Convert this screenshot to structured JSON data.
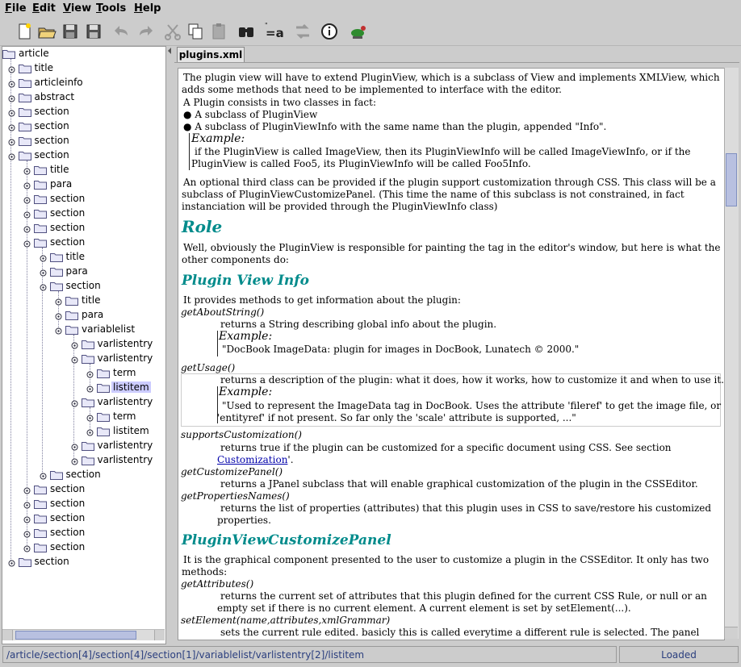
{
  "menu": [
    "File",
    "Edit",
    "View",
    "Tools",
    "Help"
  ],
  "toolbar": [
    "new-icon",
    "open-icon",
    "save-icon",
    "save-as-icon",
    "undo-icon",
    "redo-icon",
    "cut-icon",
    "copy-icon",
    "paste-icon",
    "find-icon",
    "replace-text-icon",
    "replace-icon",
    "about-icon",
    "plugin-icon"
  ],
  "tab_label": "plugins.xml",
  "tree": [
    {
      "label": "article",
      "level": 0,
      "handle": "none"
    },
    {
      "label": "title",
      "level": 1,
      "handle": "collapsed"
    },
    {
      "label": "articleinfo",
      "level": 1,
      "handle": "collapsed"
    },
    {
      "label": "abstract",
      "level": 1,
      "handle": "collapsed"
    },
    {
      "label": "section",
      "level": 1,
      "handle": "collapsed"
    },
    {
      "label": "section",
      "level": 1,
      "handle": "collapsed"
    },
    {
      "label": "section",
      "level": 1,
      "handle": "collapsed"
    },
    {
      "label": "section",
      "level": 1,
      "handle": "expanded"
    },
    {
      "label": "title",
      "level": 2,
      "handle": "collapsed"
    },
    {
      "label": "para",
      "level": 2,
      "handle": "collapsed"
    },
    {
      "label": "section",
      "level": 2,
      "handle": "collapsed"
    },
    {
      "label": "section",
      "level": 2,
      "handle": "collapsed"
    },
    {
      "label": "section",
      "level": 2,
      "handle": "collapsed"
    },
    {
      "label": "section",
      "level": 2,
      "handle": "expanded"
    },
    {
      "label": "title",
      "level": 3,
      "handle": "collapsed"
    },
    {
      "label": "para",
      "level": 3,
      "handle": "collapsed"
    },
    {
      "label": "section",
      "level": 3,
      "handle": "expanded"
    },
    {
      "label": "title",
      "level": 4,
      "handle": "collapsed"
    },
    {
      "label": "para",
      "level": 4,
      "handle": "collapsed"
    },
    {
      "label": "variablelist",
      "level": 4,
      "handle": "expanded"
    },
    {
      "label": "varlistentry",
      "level": 5,
      "handle": "collapsed"
    },
    {
      "label": "varlistentry",
      "level": 5,
      "handle": "expanded"
    },
    {
      "label": "term",
      "level": 6,
      "handle": "collapsed"
    },
    {
      "label": "listitem",
      "level": 6,
      "handle": "collapsed",
      "selected": true
    },
    {
      "label": "varlistentry",
      "level": 5,
      "handle": "expanded"
    },
    {
      "label": "term",
      "level": 6,
      "handle": "collapsed"
    },
    {
      "label": "listitem",
      "level": 6,
      "handle": "collapsed"
    },
    {
      "label": "varlistentry",
      "level": 5,
      "handle": "collapsed"
    },
    {
      "label": "varlistentry",
      "level": 5,
      "handle": "collapsed"
    },
    {
      "label": "section",
      "level": 3,
      "handle": "collapsed"
    },
    {
      "label": "section",
      "level": 2,
      "handle": "collapsed"
    },
    {
      "label": "section",
      "level": 2,
      "handle": "collapsed"
    },
    {
      "label": "section",
      "level": 2,
      "handle": "collapsed"
    },
    {
      "label": "section",
      "level": 2,
      "handle": "collapsed"
    },
    {
      "label": "section",
      "level": 2,
      "handle": "collapsed"
    },
    {
      "label": "section",
      "level": 1,
      "handle": "collapsed"
    }
  ],
  "doc": {
    "p1a": "The plugin view will have to extend PluginView, which is a subclass of View and implements XMLView, which",
    "p1b": "adds some methods that need to be implemented to interface with the editor.",
    "p2": "A Plugin consists in two classes in fact:",
    "b1": "A subclass of PluginView",
    "b2": "A subclass of PluginViewInfo with the same name than the plugin, appended \"Info\".",
    "ex1_label": "Example:",
    "ex1a": "if the PluginView is called ImageView, then its PluginViewInfo will be called ImageViewInfo, or if the",
    "ex1b": "PluginView is called Foo5, its PluginViewInfo will be called Foo5Info.",
    "p3a": "An optional third class can be provided if the plugin support customization through CSS. This class will be a",
    "p3b": "subclass of PluginViewCustomizePanel. (This time the name of this subclass is not constrained, in fact",
    "p3c": "instanciation will be provided through the PluginViewInfo class)",
    "h_role": "Role",
    "p4a": "Well, obviously the PluginView is responsible for painting the tag in the editor's window, but here is what the",
    "p4b": "other components do:",
    "h_pvi": "Plugin View Info",
    "p5": "It provides methods to get information about the plugin:",
    "t1": "getAboutString()",
    "d1": "returns a String describing global info about the plugin.",
    "ex2_label": "Example:",
    "ex2": "\"DocBook ImageData: plugin for images in DocBook, Lunatech © 2000.\"",
    "t2": "getUsage()",
    "d2": "returns a description of the plugin: what it does, how it works, how to customize it and when to use it.",
    "ex3_label": "Example:",
    "ex3a": "\"Used to represent the ImageData tag in DocBook. Uses the attribute 'fileref' to get the image file, or",
    "ex3b": "'entityref' if not present. So far only the 'scale' attribute is supported, ...\"",
    "t3": "supportsCustomization()",
    "d3": "returns true if the plugin can be customized for a specific document using CSS. See section",
    "d3_link": "Customization",
    "d3_end": "'.",
    "t4": "getCustomizePanel()",
    "d4": "returns a JPanel subclass that will enable graphical customization of the plugin in the CSSEditor.",
    "t5": "getPropertiesNames()",
    "d5a": "returns the list of properties (attributes) that this plugin uses in CSS to save/restore his customized",
    "d5b": "properties.",
    "h_pvcp": "PluginViewCustomizePanel",
    "p6a": "It is the graphical component presented to the user to customize a plugin in the CSSEditor. It only has two",
    "p6b": "methods:",
    "t6": "getAttributes()",
    "d6a": "returns the current set of attributes that this plugin defined for the current CSS Rule, or null or an",
    "d6b": "empty set if there is no current element. A current element is set by setElement(...).",
    "t7": "setElement(name,attributes,xmlGrammar)",
    "d7": "sets the current rule edited. basicly this is called everytime a different rule is selected. The panel"
  },
  "status": {
    "path": "/article/section[4]/section[4]/section[1]/variablelist/varlistentry[2]/listitem",
    "state": "Loaded"
  }
}
